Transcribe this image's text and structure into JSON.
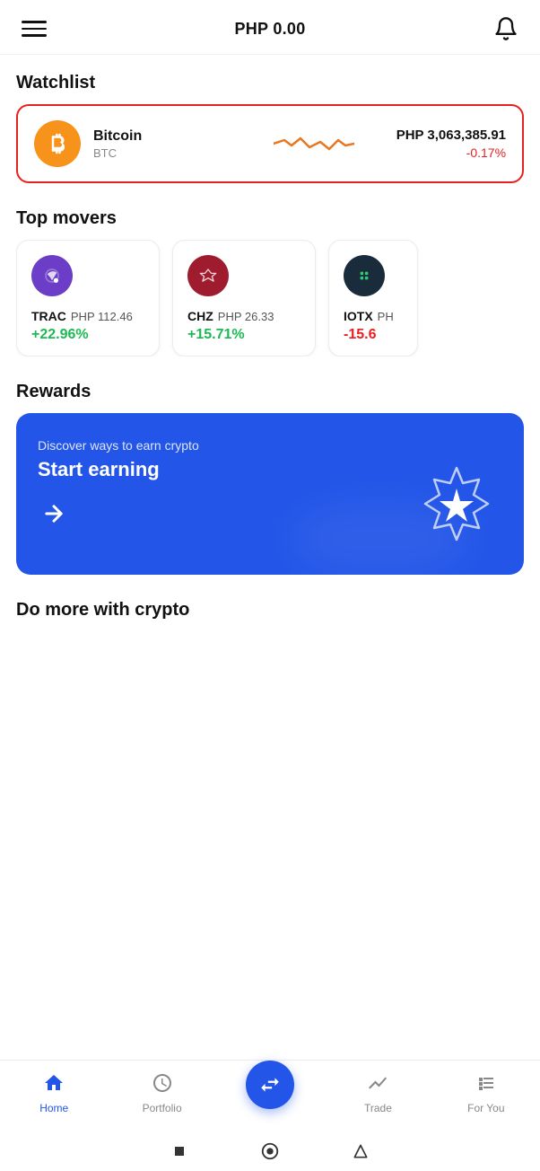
{
  "header": {
    "balance": "PHP 0.00",
    "menu_label": "menu",
    "bell_label": "notifications"
  },
  "watchlist": {
    "section_title": "Watchlist",
    "coin_name": "Bitcoin",
    "coin_ticker": "BTC",
    "coin_price": "PHP 3,063,385.91",
    "coin_change": "-0.17%"
  },
  "top_movers": {
    "section_title": "Top movers",
    "coins": [
      {
        "ticker": "TRAC",
        "price": "PHP 112.46",
        "change": "+22.96%",
        "positive": true,
        "color": "#6c3dc7",
        "text_color": "#1db954"
      },
      {
        "ticker": "CHZ",
        "price": "PHP 26.33",
        "change": "+15.71%",
        "positive": true,
        "color": "#9e1c2e",
        "text_color": "#1db954"
      },
      {
        "ticker": "IOTX",
        "price": "PH...",
        "change": "-15.6",
        "positive": false,
        "color": "#1a2b3c",
        "text_color": "#e82020"
      }
    ]
  },
  "rewards": {
    "section_title": "Rewards",
    "subtitle": "Discover ways to earn crypto",
    "title": "Start earning",
    "arrow_label": "arrow-right"
  },
  "do_more": {
    "section_title": "Do more with crypto"
  },
  "bottom_nav": {
    "items": [
      {
        "label": "Home",
        "active": true
      },
      {
        "label": "Portfolio",
        "active": false
      },
      {
        "label": "Swap",
        "active": false,
        "is_swap": true
      },
      {
        "label": "Trade",
        "active": false
      },
      {
        "label": "For You",
        "active": false
      }
    ]
  },
  "system_nav": {
    "back_label": "back",
    "home_label": "system-home",
    "recent_label": "recent"
  }
}
